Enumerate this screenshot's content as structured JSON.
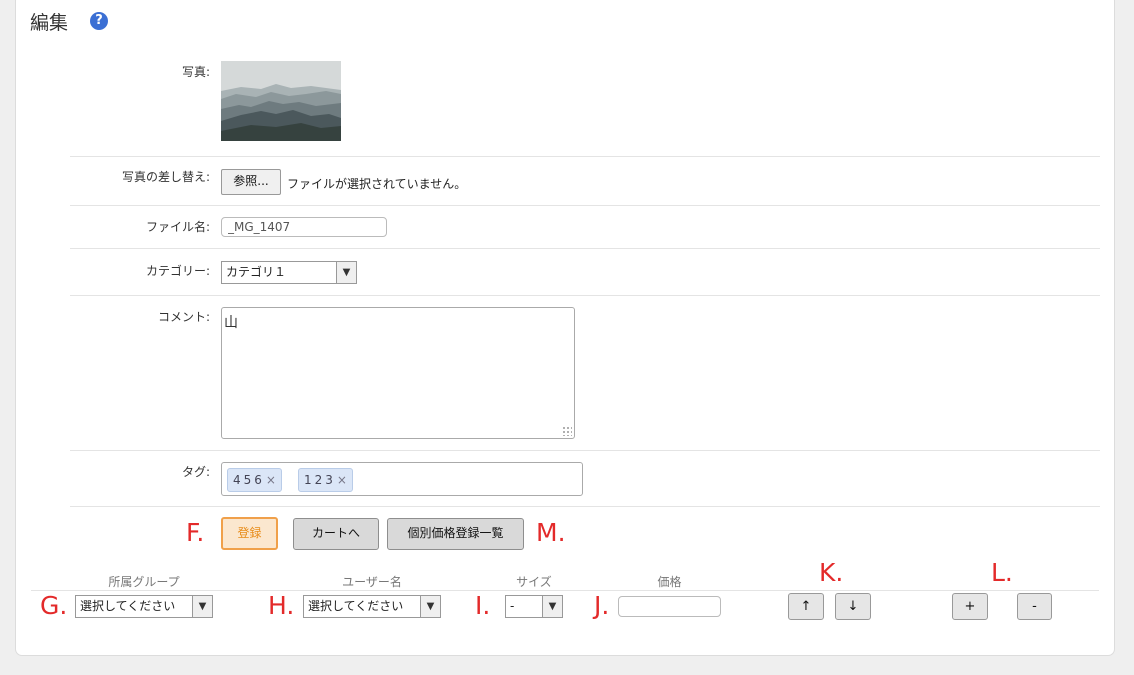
{
  "page": {
    "title": "編集",
    "help_icon": "question-circle-icon"
  },
  "form": {
    "photo_label": "写真:",
    "replace_label": "写真の差し替え:",
    "browse_button": "参照...",
    "file_status": "ファイルが選択されていません。",
    "filename_label": "ファイル名:",
    "filename_value": "_MG_1407",
    "category_label": "カテゴリー:",
    "category_value": "カテゴリ１",
    "comment_label": "コメント:",
    "comment_value": "山",
    "tags_label": "タグ:",
    "tags": [
      {
        "text": "456"
      },
      {
        "text": "123"
      }
    ],
    "tag_remove_glyph": "×"
  },
  "actions": {
    "register": "登録",
    "cart": "カートへ",
    "price_list": "個別価格登録一覧"
  },
  "grid": {
    "headers": {
      "group": "所属グループ",
      "user": "ユーザー名",
      "size": "サイズ",
      "price": "価格"
    },
    "group_select": "選択してください",
    "user_select": "選択してください",
    "size_select": "-",
    "price_value": "",
    "up_button": "↑",
    "down_button": "↓",
    "add_button": "+",
    "remove_button": "-"
  },
  "markers": {
    "f": "F.",
    "g": "G.",
    "h": "H.",
    "i": "I.",
    "j": "J.",
    "k": "K.",
    "l": "L.",
    "m": "M."
  },
  "colors": {
    "marker": "#e32a2a",
    "accent": "#f0a04a",
    "help": "#3b6fd4"
  }
}
